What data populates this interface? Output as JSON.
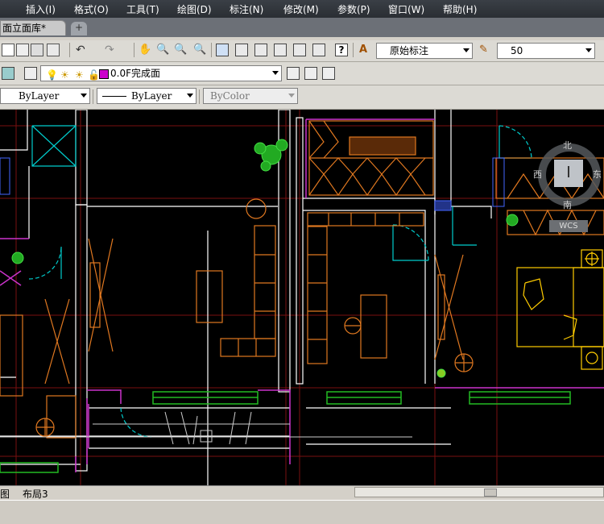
{
  "menu": {
    "items": [
      "插入(I)",
      "格式(O)",
      "工具(T)",
      "绘图(D)",
      "标注(N)",
      "修改(M)",
      "参数(P)",
      "窗口(W)",
      "帮助(H)"
    ]
  },
  "document": {
    "tab_label": "面立面库*"
  },
  "toolbar_annotation": {
    "dim_style": "原始标注",
    "scale_value": "50"
  },
  "toolbar_layer": {
    "layer_name": "0.0F完成面",
    "layer_color": "#cc00cc"
  },
  "toolbar_properties": {
    "color_value": "ByLayer",
    "linetype_value": "ByLayer",
    "lineweight_value": "ByColor"
  },
  "viewcube": {
    "north": "北",
    "south": "南",
    "west": "西",
    "east": "东",
    "wcs": "WCS"
  },
  "layout_tabs": {
    "model_tab": "图",
    "layout3_tab": "布局3"
  },
  "colors": {
    "wall": "#ffffff",
    "furniture": "#e07820",
    "window": "#22bb22",
    "door": "#00cccc",
    "partition": "#cc33cc",
    "fixture": "#ffcc00",
    "blue_fixture": "#4466ff",
    "guide": "#7a1010"
  }
}
